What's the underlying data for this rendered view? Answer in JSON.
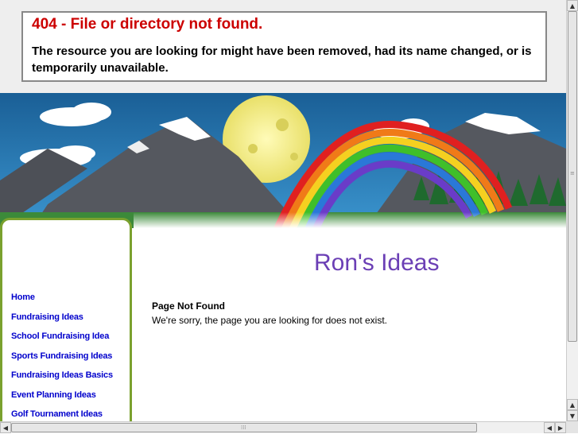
{
  "error": {
    "title": "404 - File or directory not found.",
    "message": "The resource you are looking for might have been removed, had its name changed, or is temporarily unavailable."
  },
  "site": {
    "title": "Ron's Ideas"
  },
  "nav": {
    "items": [
      {
        "label": "Home"
      },
      {
        "label": "Fundraising Ideas"
      },
      {
        "label": "School Fundraising Idea"
      },
      {
        "label": "Sports Fundraising Ideas"
      },
      {
        "label": "Fundraising Ideas Basics"
      },
      {
        "label": "Event Planning Ideas"
      },
      {
        "label": "Golf Tournament Ideas"
      }
    ]
  },
  "content": {
    "heading": "Page Not Found",
    "text": "We're sorry, the page you are looking for does not exist."
  },
  "colors": {
    "error_red": "#cc0000",
    "title_purple": "#6b3fb5",
    "nav_link": "#0000cc",
    "sidebar_border": "#7aa12e",
    "sky": "#1e6fa8"
  },
  "icons": {
    "scroll_up": "▲",
    "scroll_down": "▼",
    "scroll_left": "◀",
    "scroll_right": "▶"
  }
}
